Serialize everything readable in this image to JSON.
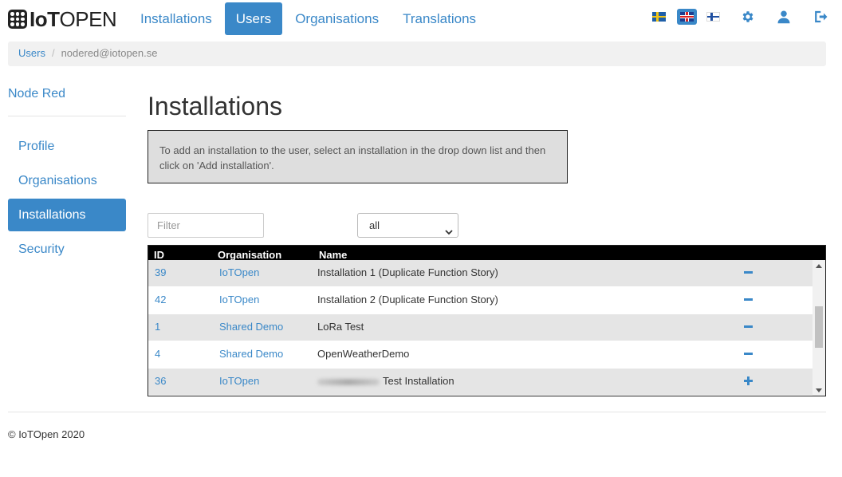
{
  "brand": {
    "logo_bold": "IoT",
    "logo_thin": "OPEN"
  },
  "nav": {
    "links": [
      {
        "label": "Installations"
      },
      {
        "label": "Users",
        "active": true
      },
      {
        "label": "Organisations"
      },
      {
        "label": "Translations"
      }
    ],
    "languages": [
      "swedish-flag-icon",
      "uk-flag-icon",
      "finnish-flag-icon"
    ],
    "active_language": "uk-flag-icon",
    "icons": [
      "gear-icon",
      "user-icon",
      "logout-icon"
    ]
  },
  "breadcrumb": {
    "root": "Users",
    "separator": "/",
    "current": "nodered@iotopen.se"
  },
  "sidebar": {
    "title": "Node Red",
    "items": [
      {
        "label": "Profile"
      },
      {
        "label": "Organisations"
      },
      {
        "label": "Installations",
        "active": true
      },
      {
        "label": "Security"
      }
    ]
  },
  "main": {
    "title": "Installations",
    "info_text": "To add an installation to the user, select an installation in the drop down list and then click on 'Add installation'.",
    "filter_placeholder": "Filter",
    "select_value": "all"
  },
  "table": {
    "headers": {
      "id": "ID",
      "organisation": "Organisation",
      "name": "Name"
    },
    "rows": [
      {
        "id": "39",
        "organisation": "IoTOpen",
        "name": "Installation 1 (Duplicate Function Story)",
        "action": "remove"
      },
      {
        "id": "42",
        "organisation": "IoTOpen",
        "name": "Installation 2 (Duplicate Function Story)",
        "action": "remove"
      },
      {
        "id": "1",
        "organisation": "Shared Demo",
        "name": "LoRa Test",
        "action": "remove"
      },
      {
        "id": "4",
        "organisation": "Shared Demo",
        "name": "OpenWeatherDemo",
        "action": "remove"
      },
      {
        "id": "36",
        "organisation": "IoTOpen",
        "name": "Test Installation",
        "action": "add",
        "redacted_prefix": true
      }
    ]
  },
  "colors": {
    "accent": "#3a88c8",
    "row_odd": "#e5e5e5",
    "header_bg": "#000000"
  },
  "footer": {
    "copyright": "© IoTOpen 2020"
  }
}
